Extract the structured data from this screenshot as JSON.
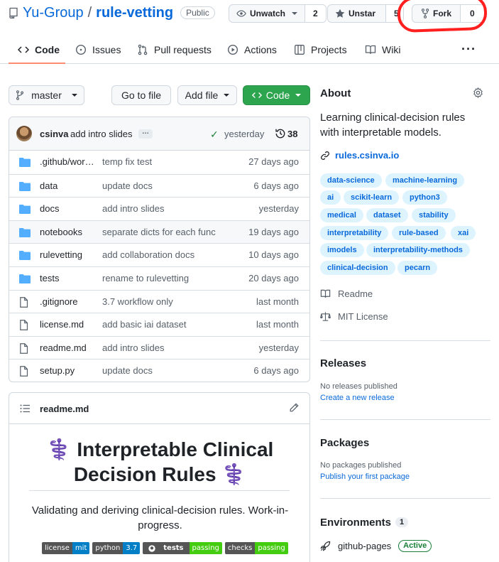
{
  "repo": {
    "owner": "Yu-Group",
    "separator": "/",
    "name": "rule-vetting",
    "visibility": "Public"
  },
  "header_actions": {
    "watch": {
      "label": "Unwatch",
      "count": "2"
    },
    "star": {
      "label": "Unstar",
      "count": "5"
    },
    "fork": {
      "label": "Fork",
      "count": "0"
    }
  },
  "tabs": [
    {
      "label": "Code",
      "icon": "code-icon",
      "active": true
    },
    {
      "label": "Issues",
      "icon": "issue-opened-icon"
    },
    {
      "label": "Pull requests",
      "icon": "git-pull-request-icon"
    },
    {
      "label": "Actions",
      "icon": "play-icon"
    },
    {
      "label": "Projects",
      "icon": "table-icon"
    },
    {
      "label": "Wiki",
      "icon": "book-icon"
    }
  ],
  "toolbar": {
    "branch": "master",
    "go_to_file": "Go to file",
    "add_file": "Add file",
    "code": "Code"
  },
  "latest_commit": {
    "author": "csinva",
    "message": "add intro slides",
    "time": "yesterday",
    "commits": "38"
  },
  "files": [
    {
      "name": ".github/workflows",
      "message": "temp fix test",
      "age": "27 days ago",
      "type": "dir"
    },
    {
      "name": "data",
      "message": "update docs",
      "age": "6 days ago",
      "type": "dir"
    },
    {
      "name": "docs",
      "message": "add intro slides",
      "age": "yesterday",
      "type": "dir"
    },
    {
      "name": "notebooks",
      "message": "separate dicts for each func",
      "age": "19 days ago",
      "type": "dir"
    },
    {
      "name": "rulevetting",
      "message": "add collaboration docs",
      "age": "10 days ago",
      "type": "dir"
    },
    {
      "name": "tests",
      "message": "rename to rulevetting",
      "age": "20 days ago",
      "type": "dir"
    },
    {
      "name": ".gitignore",
      "message": "3.7 workflow only",
      "age": "last month",
      "type": "file"
    },
    {
      "name": "license.md",
      "message": "add basic iai dataset",
      "age": "last month",
      "type": "file"
    },
    {
      "name": "readme.md",
      "message": "add intro slides",
      "age": "yesterday",
      "type": "file"
    },
    {
      "name": "setup.py",
      "message": "update docs",
      "age": "6 days ago",
      "type": "file"
    }
  ],
  "readme": {
    "filename": "readme.md",
    "heading_line1": "⚕️ Interpretable Clinical",
    "heading_line2": "Decision Rules ⚕️",
    "description": "Validating and deriving clinical-decision rules. Work-in-progress.",
    "badges": [
      {
        "label": "license",
        "value": "mit",
        "color": "#007ec6"
      },
      {
        "label": "python",
        "value": "3.7",
        "color": "#007ec6"
      },
      {
        "label": "tests",
        "value": "passing",
        "color": "#4c1"
      },
      {
        "label": "checks",
        "value": "passing",
        "color": "#4c1"
      }
    ]
  },
  "about": {
    "title": "About",
    "description": "Learning clinical-decision rules with interpretable models.",
    "website": "rules.csinva.io",
    "topics": [
      "data-science",
      "machine-learning",
      "ai",
      "scikit-learn",
      "python3",
      "medical",
      "dataset",
      "stability",
      "interpretability",
      "rule-based",
      "xai",
      "imodels",
      "interpretability-methods",
      "clinical-decision",
      "pecarn"
    ],
    "readme_label": "Readme",
    "license_label": "MIT License"
  },
  "releases": {
    "title": "Releases",
    "empty": "No releases published",
    "cta": "Create a new release"
  },
  "packages": {
    "title": "Packages",
    "empty": "No packages published",
    "cta": "Publish your first package"
  },
  "environments": {
    "title": "Environments",
    "count": "1",
    "name": "github-pages",
    "status": "Active"
  },
  "colors": {
    "link": "#0969da",
    "primary_button": "#2da44e",
    "tab_underline": "#fd8c73",
    "annotation": "#ff1f1f"
  }
}
